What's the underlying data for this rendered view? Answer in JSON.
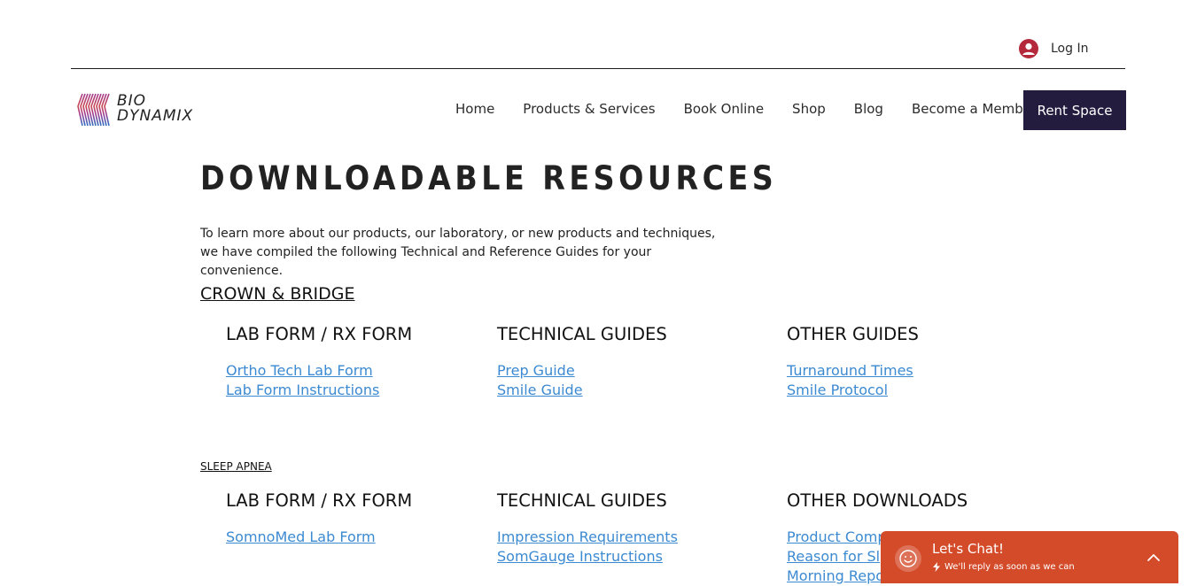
{
  "header": {
    "login_label": "Log In",
    "logo_line1": "BIO",
    "logo_line2": "DYNAMIX",
    "nav": [
      "Home",
      "Products & Services",
      "Book Online",
      "Shop",
      "Blog",
      "Become a Member"
    ],
    "cta_label": "Rent Space"
  },
  "main": {
    "title": "DOWNLOADABLE RESOURCES",
    "intro": "To learn more about our products, our laboratory, or new products and techniques, we have compiled the following Technical and Reference Guides for your convenience.",
    "crown_bridge": {
      "title": "CROWN & BRIDGE",
      "columns": [
        {
          "heading": "LAB FORM / RX FORM",
          "links": [
            "Ortho Tech Lab Form",
            "Lab Form Instructions"
          ]
        },
        {
          "heading": "TECHNICAL GUIDES",
          "links": [
            "Prep Guide",
            "Smile Guide"
          ]
        },
        {
          "heading": "OTHER GUIDES",
          "links": [
            "Turnaround Times",
            "Smile Protocol"
          ]
        }
      ]
    },
    "sleep_apnea": {
      "title": "SLEEP APNEA",
      "columns": [
        {
          "heading": "LAB FORM / RX FORM",
          "links": [
            "SomnoMed Lab Form"
          ]
        },
        {
          "heading": "TECHNICAL GUIDES",
          "links": [
            "Impression Requirements",
            "SomGauge Instructions"
          ]
        },
        {
          "heading": "OTHER DOWNLOADS",
          "links": [
            "Product Comp",
            "Reason for Sl",
            "Morning Repo"
          ]
        }
      ]
    }
  },
  "chat": {
    "title": "Let's Chat!",
    "subtitle": "We'll reply as soon as we can"
  },
  "colors": {
    "accent_dark": "#231c3f",
    "link": "#3c8ad1",
    "chat_bg": "#d44b2a",
    "avatar": "#c2273a"
  }
}
